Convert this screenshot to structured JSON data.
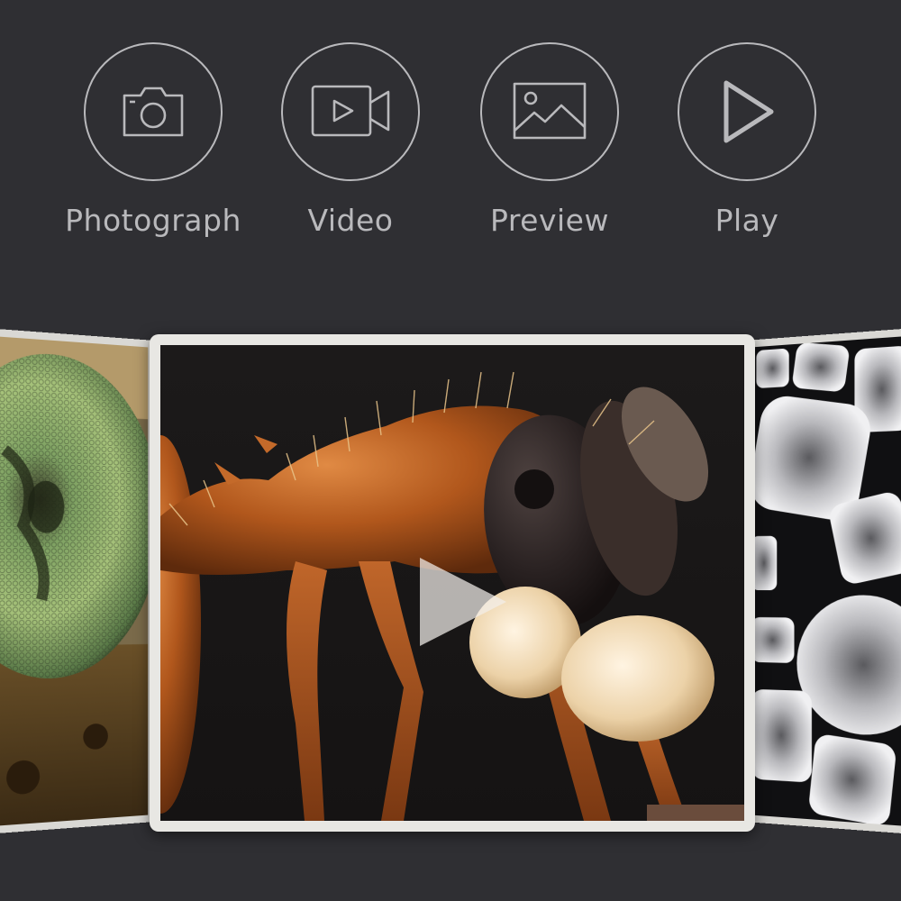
{
  "modes": [
    {
      "id": "photograph",
      "label": "Photograph",
      "icon": "camera-icon"
    },
    {
      "id": "video",
      "label": "Video",
      "icon": "video-camera-icon"
    },
    {
      "id": "preview",
      "label": "Preview",
      "icon": "image-icon"
    },
    {
      "id": "play",
      "label": "Play",
      "icon": "play-icon"
    }
  ],
  "carousel": {
    "items": [
      {
        "position": "left",
        "subject": "insect compound eye macro"
      },
      {
        "position": "center",
        "subject": "ant carrying larva macro",
        "overlay_icon": "play-icon"
      },
      {
        "position": "right",
        "subject": "sand grains macro"
      }
    ]
  },
  "colors": {
    "background": "#2f2f33",
    "icon_stroke": "#b9b9bc",
    "card_frame": "#e8e7e3"
  }
}
